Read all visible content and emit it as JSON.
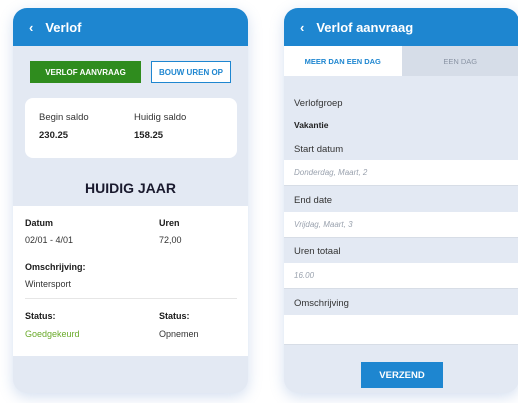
{
  "left": {
    "header": {
      "back": "‹",
      "title": "Verlof"
    },
    "buttons": {
      "request": "VERLOF AANVRAAG",
      "build_hours": "BOUW UREN OP"
    },
    "saldo": {
      "begin_label": "Begin saldo",
      "begin_value": "230.25",
      "current_label": "Huidig saldo",
      "current_value": "158.25"
    },
    "year_title": "HUIDIG JAAR",
    "detail": {
      "date_label": "Datum",
      "date_value": "02/01 - 4/01",
      "hours_label": "Uren",
      "hours_value": "72,00",
      "desc_label": "Omschrijving:",
      "desc_value": "Wintersport",
      "status1_label": "Status:",
      "status1_value": "Goedgekeurd",
      "status2_label": "Status:",
      "status2_value": "Opnemen"
    }
  },
  "right": {
    "header": {
      "back": "‹",
      "title": "Verlof aanvraag"
    },
    "tabs": {
      "multi_day": "MEER DAN EEN DAG",
      "single_day": "EEN DAG"
    },
    "form": {
      "group_label": "Verlofgroep",
      "group_value": "Vakantie",
      "start_label": "Start datum",
      "start_placeholder": "Donderdag, Maart, 2",
      "end_label": "End date",
      "end_placeholder": "Vrijdag, Maart, 3",
      "hours_label": "Uren totaal",
      "hours_placeholder": "16.00",
      "desc_label": "Omschrijving",
      "desc_placeholder": ""
    },
    "submit": "VERZEND"
  },
  "colors": {
    "primary_blue": "#1e86d0",
    "approve_green": "#2f8c1e",
    "status_green": "#6aaa2a",
    "panel_bg": "#e3e9f3"
  }
}
